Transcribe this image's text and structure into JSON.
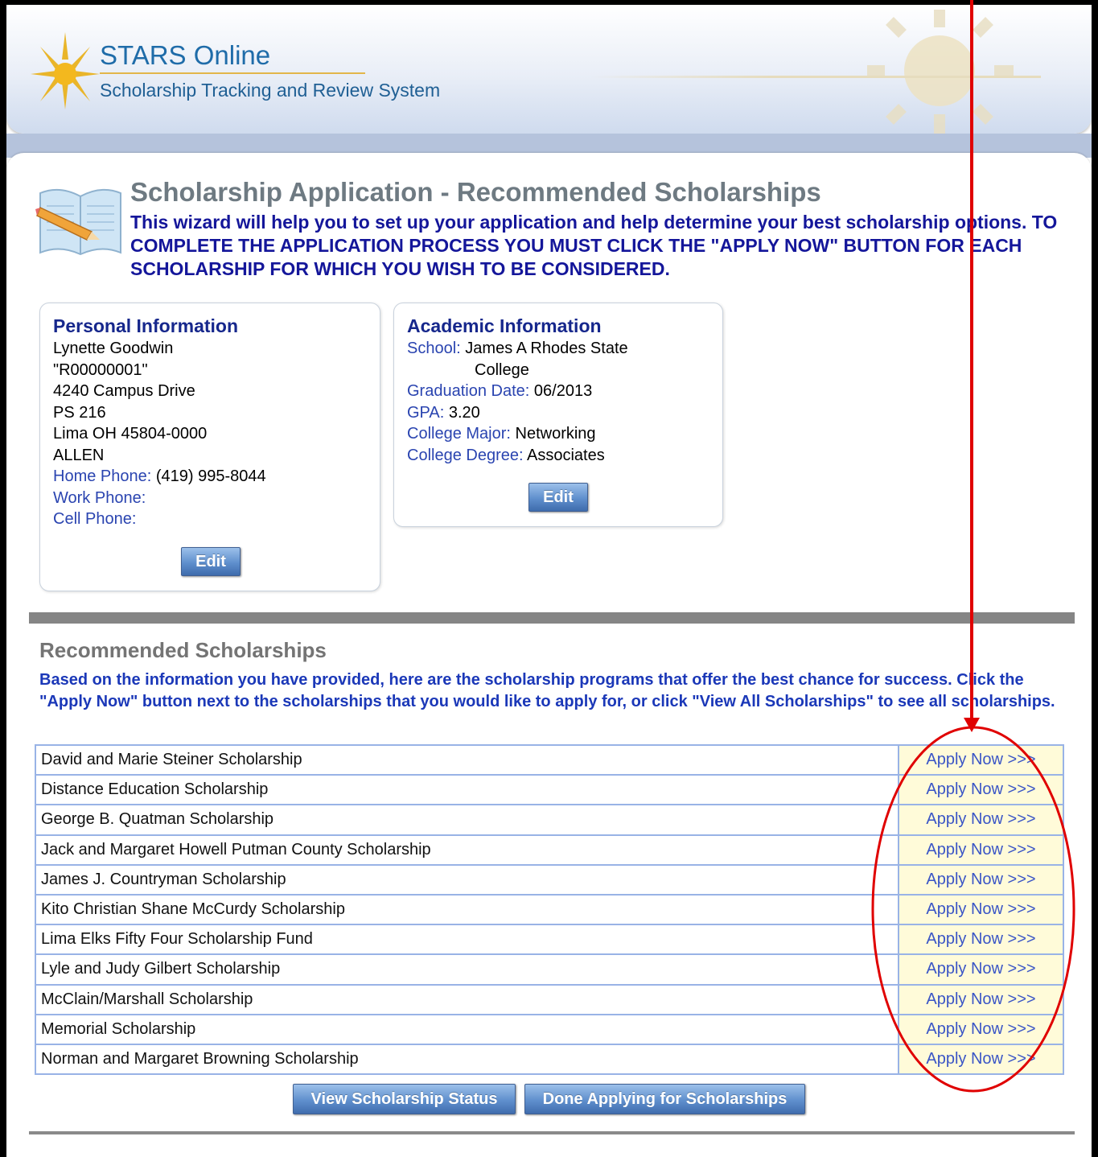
{
  "app": {
    "title": "STARS Online",
    "subtitle": "Scholarship Tracking and Review System"
  },
  "page": {
    "title": "Scholarship Application - Recommended Scholarships",
    "intro": "This wizard will help you to set up your application and help determine your best scholarship options. TO COMPLETE THE APPLICATION PROCESS YOU MUST CLICK THE \"APPLY NOW\" BUTTON FOR EACH SCHOLARSHIP FOR WHICH YOU WISH TO BE CONSIDERED."
  },
  "personal": {
    "heading": "Personal Information",
    "name": "Lynette Goodwin",
    "id": "\"R00000001\"",
    "address1": "4240 Campus Drive",
    "address2": "PS 216",
    "city_state_zip": "Lima OH 45804-0000",
    "county": "ALLEN",
    "home_phone_label": "Home Phone:",
    "home_phone": "(419) 995-8044",
    "work_phone_label": "Work Phone:",
    "work_phone": "",
    "cell_phone_label": "Cell Phone:",
    "cell_phone": "",
    "edit_label": "Edit"
  },
  "academic": {
    "heading": "Academic Information",
    "school_label": "School:",
    "school_line1": "James A Rhodes State",
    "school_line2": "College",
    "grad_label": "Graduation Date:",
    "grad_date": "06/2013",
    "gpa_label": "GPA:",
    "gpa": "3.20",
    "major_label": "College Major:",
    "major": "Networking",
    "degree_label": "College Degree:",
    "degree": "Associates",
    "edit_label": "Edit"
  },
  "recommended": {
    "heading": "Recommended Scholarships",
    "text": "Based on the information you have provided, here are the scholarship programs that offer the best chance for success. Click the \"Apply Now\" button next to the scholarships that you would like to apply for, or click \"View All Scholarships\" to see all scholarships.",
    "apply_label": "Apply Now >>>",
    "scholarships": [
      "David and Marie Steiner Scholarship",
      "Distance Education Scholarship",
      "George B. Quatman Scholarship",
      "Jack and Margaret Howell Putman County Scholarship",
      "James J. Countryman Scholarship",
      "Kito Christian Shane McCurdy Scholarship",
      "Lima Elks Fifty Four Scholarship Fund",
      "Lyle and Judy Gilbert Scholarship",
      "McClain/Marshall Scholarship",
      "Memorial Scholarship",
      "Norman and Margaret Browning Scholarship"
    ]
  },
  "buttons": {
    "view_status": "View Scholarship Status",
    "done": "Done Applying for Scholarships"
  },
  "colors": {
    "annotation": "#e00000",
    "heading_blue": "#16278c",
    "apply_bg": "#fffbd9"
  }
}
